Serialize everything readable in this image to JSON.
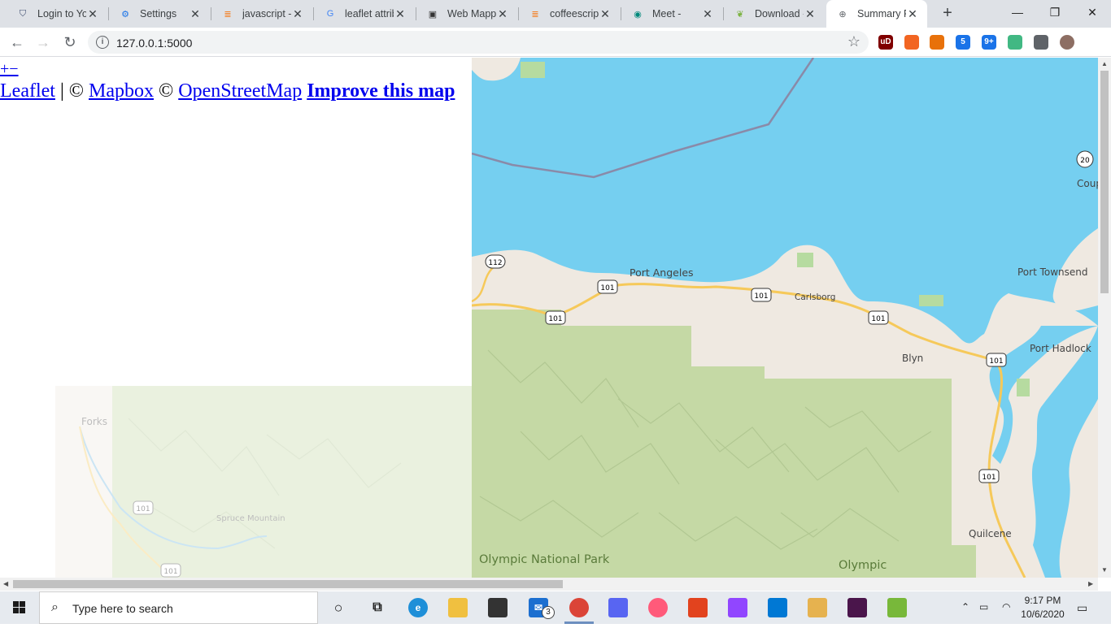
{
  "browser": {
    "tabs": [
      {
        "title": "Login to Yo",
        "icon": "shield-icon",
        "active": false
      },
      {
        "title": "Settings",
        "icon": "gear-icon",
        "active": false
      },
      {
        "title": "javascript -",
        "icon": "stackoverflow-icon",
        "active": false
      },
      {
        "title": "leaflet attrib",
        "icon": "google-icon",
        "active": false
      },
      {
        "title": "Web Mappi",
        "icon": "pdf-icon",
        "active": false
      },
      {
        "title": "coffeescript",
        "icon": "stackoverflow-icon",
        "active": false
      },
      {
        "title": "Meet -",
        "icon": "meet-icon",
        "active": false
      },
      {
        "title": "Download -",
        "icon": "leaf-icon",
        "active": false
      },
      {
        "title": "Summary Fi",
        "icon": "globe-icon",
        "active": true
      }
    ],
    "new_tab_label": "+",
    "window_controls": {
      "minimize": "—",
      "maximize": "❐",
      "close": "✕"
    },
    "url": "127.0.0.1:5000",
    "extensions": [
      {
        "name": "ublock-icon",
        "label": "uD",
        "color": "#800000"
      },
      {
        "name": "extension-orange-icon",
        "label": "",
        "color": "#f26522"
      },
      {
        "name": "tag-extension-icon",
        "label": "",
        "color": "#e8710a"
      },
      {
        "name": "gear-extension-icon",
        "label": "5",
        "color": "#1a73e8"
      },
      {
        "name": "badge-extension-icon",
        "label": "9+",
        "color": "#1a73e8"
      },
      {
        "name": "vue-extension-icon",
        "label": "",
        "color": "#41b883"
      },
      {
        "name": "puzzle-icon",
        "label": "",
        "color": "#5f6368"
      },
      {
        "name": "profile-avatar",
        "label": "",
        "color": "#8d6e63"
      }
    ]
  },
  "page": {
    "zoom_controls": "+−",
    "attribution": {
      "leaflet": "Leaflet",
      "sep1": " | © ",
      "mapbox": "Mapbox",
      "sep2": " © ",
      "osm": "OpenStreetMap",
      "sep3": " ",
      "improve": "Improve this map"
    },
    "map_labels": {
      "port_angeles": "Port Angeles",
      "carlsborg": "Carlsborg",
      "port_townsend": "Port Townsend",
      "port_hadlock": "Port Hadlock",
      "blyn": "Blyn",
      "quilcene": "Quilcene",
      "olympic_national_park": "Olympic National Park",
      "olympic": "Olympic",
      "coupeville": "Coup",
      "forks": "Forks",
      "spruce_mountain": "Spruce Mountain",
      "route_112": "112",
      "route_101": "101",
      "route_20": "20"
    },
    "colors": {
      "water": "#75cff0",
      "land": "#efe9e1",
      "park": "#c7dca6",
      "road": "#f6c95a"
    }
  },
  "taskbar": {
    "search_placeholder": "Type here to search",
    "mail_badge": "3",
    "time": "9:17 PM",
    "date": "10/6/2020"
  }
}
